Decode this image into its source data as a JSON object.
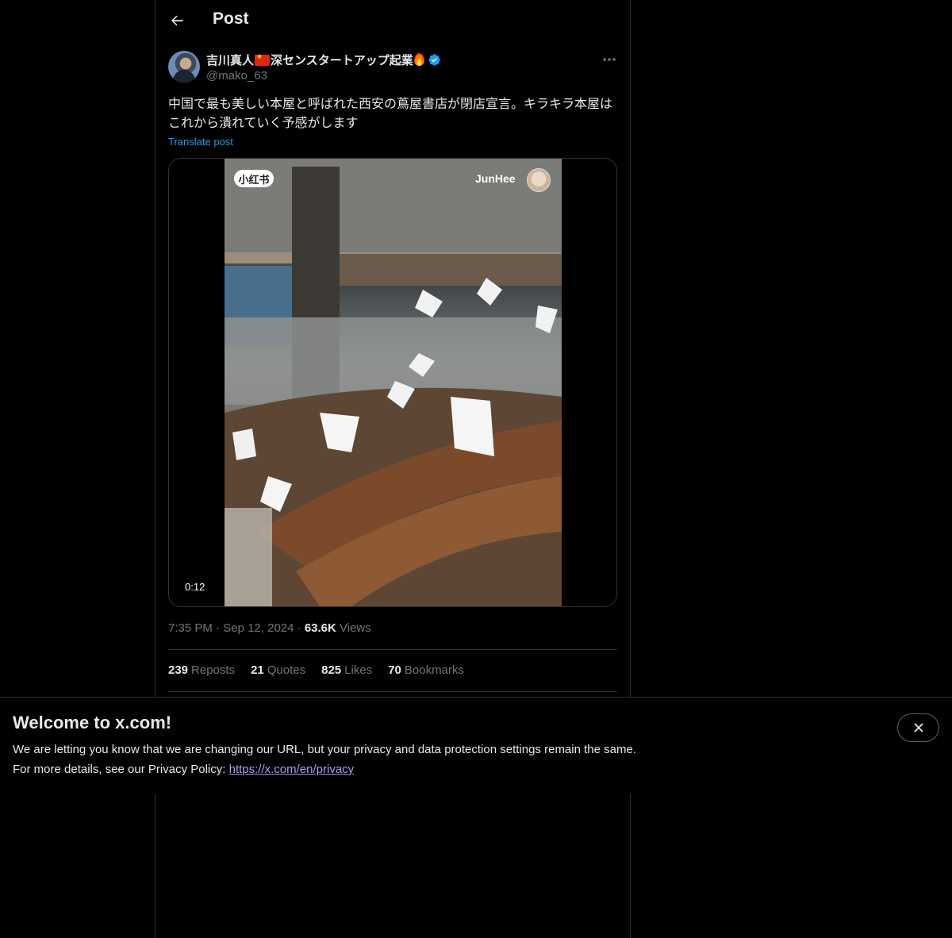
{
  "header": {
    "title": "Post",
    "back_icon": "arrow-left-icon"
  },
  "post": {
    "author": {
      "display_name_part1": "吉川真人",
      "display_name_part2": "深センスタートアップ起業",
      "handle": "@mako_63",
      "verified": true
    },
    "text": "中国で最も美しい本屋と呼ばれた西安の蔦屋書店が閉店宣言。キラキラ本屋はこれから潰れていく予感がします",
    "translate_label": "Translate post",
    "media": {
      "watermark_badge": "小红书",
      "creator_name": "JunHee",
      "duration": "0:12"
    },
    "meta": {
      "time": "7:35 PM",
      "separator": "·",
      "date": "Sep 12, 2024",
      "views_count": "63.6K",
      "views_label": "Views"
    },
    "stats": [
      {
        "count": "239",
        "label": "Reposts"
      },
      {
        "count": "21",
        "label": "Quotes"
      },
      {
        "count": "825",
        "label": "Likes"
      },
      {
        "count": "70",
        "label": "Bookmarks"
      }
    ]
  },
  "banner": {
    "title": "Welcome to x.com!",
    "line1": "We are letting you know that we are changing our URL, but your privacy and data protection settings remain the same.",
    "line2_prefix": "For more details, see our Privacy Policy:",
    "privacy_link": "https://x.com/en/privacy"
  },
  "colors": {
    "background": "#000000",
    "text": "#e7e9ea",
    "secondary_text": "#71767b",
    "accent": "#1d9bf0",
    "border": "#2f3336",
    "link_visited": "#a3a0f5"
  }
}
